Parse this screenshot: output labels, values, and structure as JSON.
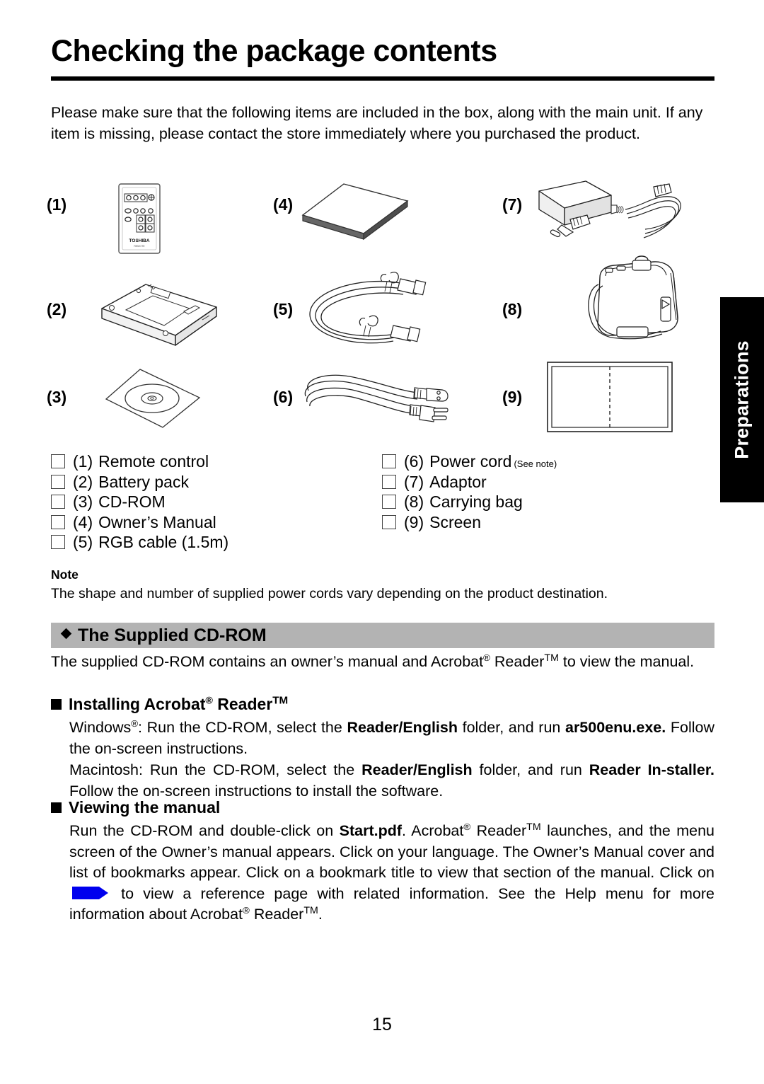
{
  "document": {
    "title": "Checking the package contents",
    "page_number": "15",
    "side_tab": "Preparations",
    "intro": "Please make sure that the following items are included in the box, along with the main unit. If any item is missing, please contact the store immediately where you purchased the product."
  },
  "items": {
    "figures": [
      {
        "number": "(1)",
        "icon": "remote-control-icon",
        "brand": "TOSHIBA"
      },
      {
        "number": "(2)",
        "icon": "battery-pack-icon"
      },
      {
        "number": "(3)",
        "icon": "cd-rom-icon"
      },
      {
        "number": "(4)",
        "icon": "owners-manual-icon"
      },
      {
        "number": "(5)",
        "icon": "rgb-cable-icon"
      },
      {
        "number": "(6)",
        "icon": "power-cord-icon"
      },
      {
        "number": "(7)",
        "icon": "adaptor-icon"
      },
      {
        "number": "(8)",
        "icon": "carrying-bag-icon"
      },
      {
        "number": "(9)",
        "icon": "screen-icon"
      }
    ],
    "checklist_left": [
      {
        "number": "(1)",
        "label": "Remote control"
      },
      {
        "number": "(2)",
        "label": "Battery pack"
      },
      {
        "number": "(3)",
        "label": "CD-ROM"
      },
      {
        "number": "(4)",
        "label": "Owner’s Manual"
      },
      {
        "number": "(5)",
        "label": "RGB cable (1.5m)"
      }
    ],
    "checklist_right": [
      {
        "number": "(6)",
        "label": "Power cord",
        "note": "(See note)"
      },
      {
        "number": "(7)",
        "label": "Adaptor",
        "note": ""
      },
      {
        "number": "(8)",
        "label": "Carrying bag",
        "note": ""
      },
      {
        "number": "(9)",
        "label": "Screen",
        "note": ""
      }
    ]
  },
  "note": {
    "heading": "Note",
    "body": "The shape and number of supplied power cords vary depending on the product destination."
  },
  "cdrom_section": {
    "heading": "The Supplied CD-ROM",
    "intro_a": "The supplied CD-ROM contains an owner’s manual and Acrobat",
    "intro_b": " Reader",
    "intro_c": " to view the manual.",
    "installing": {
      "heading_a": "Installing Acrobat",
      "heading_b": " Reader",
      "windows_1": "Windows",
      "windows_2": ": Run the CD-ROM, select the ",
      "windows_bold": "Reader/English",
      "windows_3": " folder, and run ",
      "windows_bold2": "ar500enu.exe.",
      "windows_4": " Follow the on-screen instructions.",
      "mac_1": "Macintosh: Run the CD-ROM, select the ",
      "mac_bold": "Reader/English",
      "mac_2": " folder, and run ",
      "mac_bold2": "Reader In-staller.",
      "mac_3": " Follow the on-screen instructions to install the software."
    },
    "viewing": {
      "heading": "Viewing the manual",
      "t1": "Run the CD-ROM and double-click on ",
      "b1": "Start.pdf",
      "t2": ". Acrobat",
      "t3": " Reader",
      "t4": " launches, and the menu screen of the Owner’s manual appears. Click on your language. The Owner’s Manual cover and list of bookmarks appear. Click on a bookmark title to view that section of the manual. Click on ",
      "t5": " to view a reference page with related information. See the Help menu for more information about Acrobat",
      "t6": " Reader",
      "t7": "."
    }
  },
  "symbols": {
    "registered": "®",
    "trademark": "TM",
    "diamond": "◆",
    "square": "■"
  },
  "colors": {
    "section_bar_bg": "#b3b3b3",
    "side_tab_bg": "#000000",
    "side_tab_text": "#ffffff",
    "blue_arrow": "#0000ee",
    "text": "#000000",
    "page_bg": "#ffffff"
  }
}
